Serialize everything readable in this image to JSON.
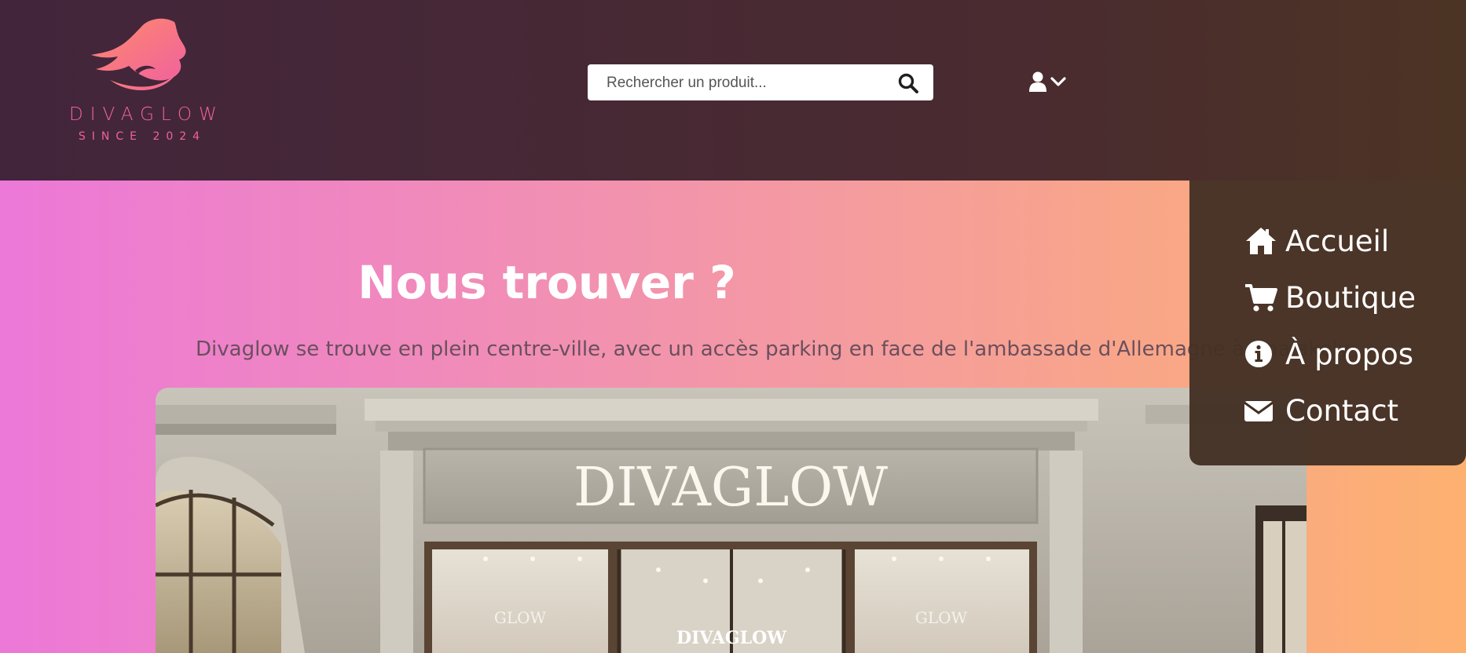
{
  "header": {
    "logo": {
      "wordmark": "DIVAGLOW",
      "tagline": "SINCE 2024",
      "colors": {
        "primary": "#f0629d",
        "gradient_end": "#ff8a6b"
      }
    },
    "search": {
      "placeholder": "Rechercher un produit...",
      "value": "",
      "button_icon": "search-icon"
    },
    "user_menu": {
      "icon": "user-icon",
      "caret": "chevron-down-icon"
    },
    "background": "#45283a"
  },
  "nav": {
    "items": [
      {
        "label": "Accueil",
        "icon": "home-icon"
      },
      {
        "label": "Boutique",
        "icon": "cart-icon"
      },
      {
        "label": "À propos",
        "icon": "info-icon"
      },
      {
        "label": "Contact",
        "icon": "envelope-icon"
      }
    ],
    "background": "#443024"
  },
  "hero": {
    "title": "Nous trouver ?",
    "subtitle": "Divaglow se trouve en plein centre-ville, avec un accès parking en face de l'ambassade d'Allemagne à Analakely",
    "gradient": [
      "#ec78d8",
      "#f49aa2",
      "#fdb170"
    ]
  },
  "storefront": {
    "sign": "DIVAGLOW",
    "window_left": "GLOW",
    "window_center": "DIVAGLOW",
    "window_right": "GLOW"
  }
}
